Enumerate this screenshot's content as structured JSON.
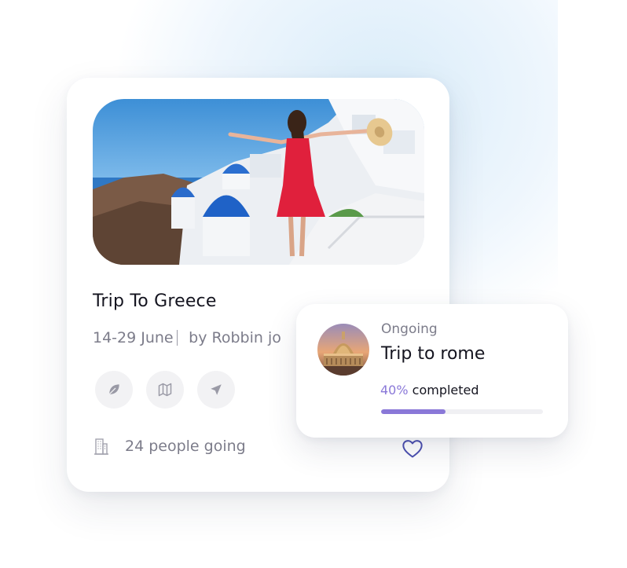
{
  "trip_card": {
    "title": "Trip To Greece",
    "dates": "14-29 June",
    "author": "by Robbin jo",
    "action_icons": [
      "leaf-icon",
      "map-icon",
      "send-icon"
    ],
    "going_icon": "building-icon",
    "people_going": "24 people going",
    "favorite_icon": "heart-icon"
  },
  "ongoing_card": {
    "status": "Ongoing",
    "title": "Trip to rome",
    "progress_percent": "40%",
    "progress_suffix": " completed",
    "progress_value": 40
  },
  "colors": {
    "accent": "#8a78d8",
    "heart": "#4b4fb0",
    "text_primary": "#14141f",
    "text_secondary": "#7c7c8a"
  }
}
